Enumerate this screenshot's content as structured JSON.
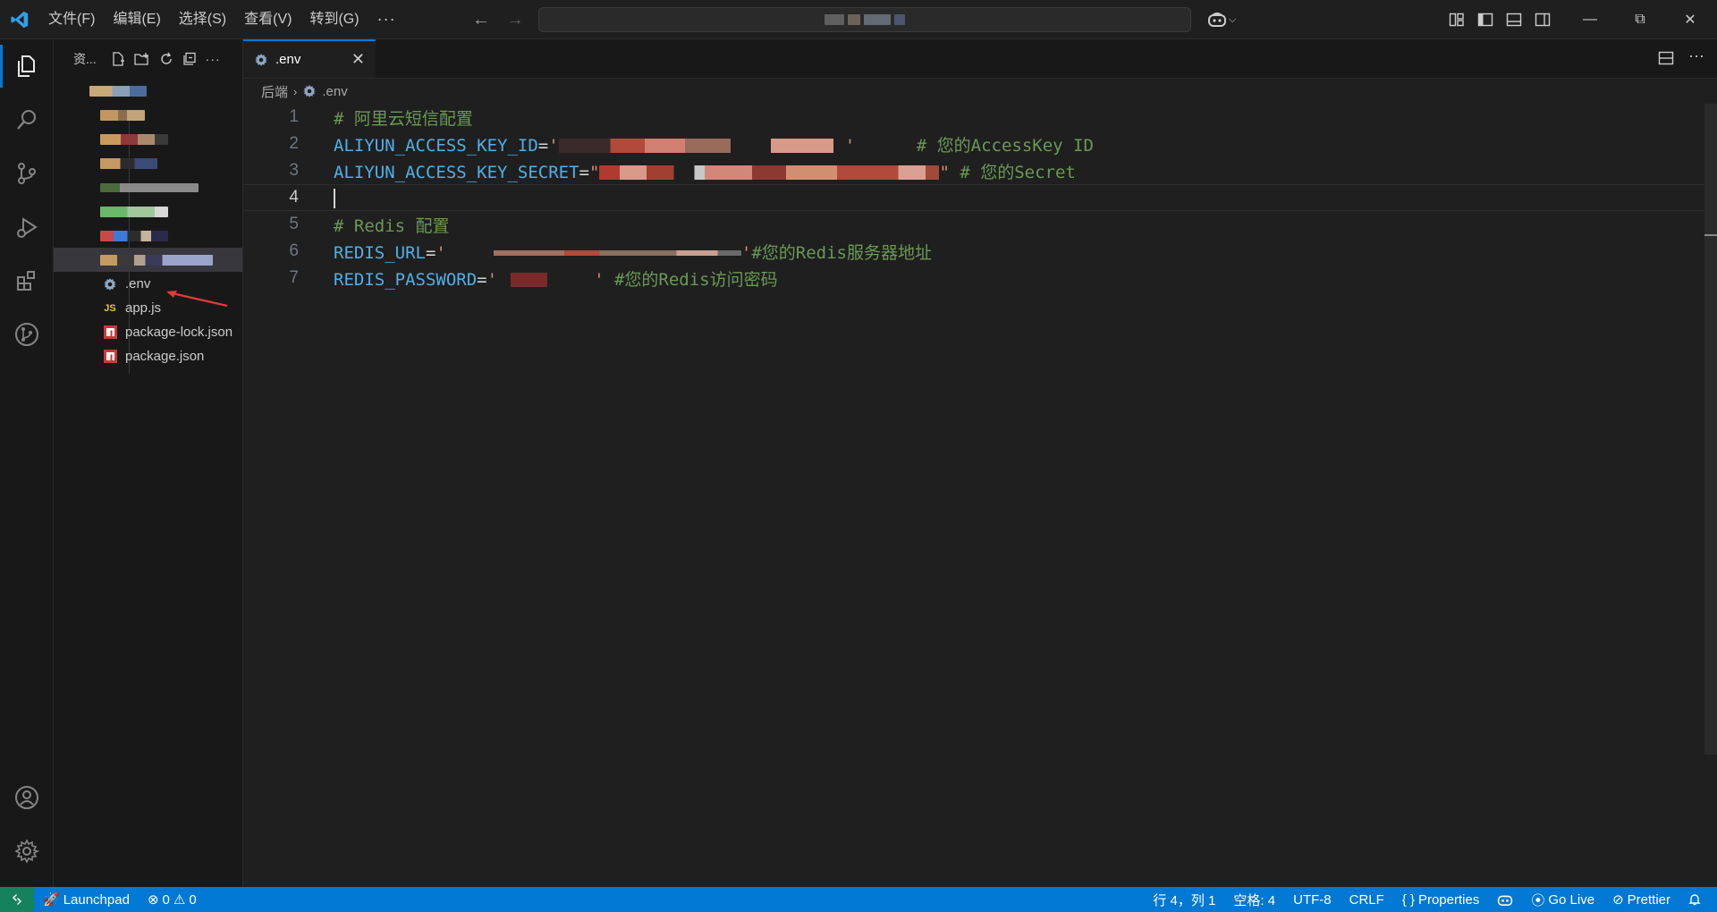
{
  "window": {
    "menu": [
      "文件(F)",
      "编辑(E)",
      "选择(S)",
      "查看(V)",
      "转到(G)"
    ],
    "more_menu": "···",
    "controls": [
      "minimize",
      "restore",
      "close"
    ]
  },
  "icons": {
    "app_logo": "vscode-logo",
    "activity": [
      "files-icon",
      "search-icon",
      "source-control-icon",
      "run-debug-icon",
      "extensions-icon",
      "git-graph-icon"
    ],
    "activity_bottom": [
      "account-icon",
      "settings-gear-icon"
    ]
  },
  "sidebar": {
    "title": "资...",
    "files": [
      {
        "label": ".env",
        "icon": "gear-icon"
      },
      {
        "label": "app.js",
        "icon": "js-icon"
      },
      {
        "label": "package-lock.json",
        "icon": "npm-icon"
      },
      {
        "label": "package.json",
        "icon": "npm-icon"
      }
    ]
  },
  "editor": {
    "tab": {
      "label": ".env"
    },
    "breadcrumb": {
      "folder": "后端",
      "file": ".env"
    },
    "lines": [
      {
        "num": "1",
        "comment": "# 阿里云短信配置"
      },
      {
        "num": "2",
        "key": "ALIYUN_ACCESS_KEY_ID",
        "op": "=",
        "q1": "'",
        "q2": "'",
        "comment": "# 您的AccessKey ID"
      },
      {
        "num": "3",
        "key": "ALIYUN_ACCESS_KEY_SECRET",
        "op": "=",
        "q1": "\"",
        "q2": "\"",
        "comment": "# 您的Secret"
      },
      {
        "num": "4"
      },
      {
        "num": "5",
        "comment": "# Redis 配置"
      },
      {
        "num": "6",
        "key": "REDIS_URL",
        "op": "=",
        "q1": "'",
        "q2": "'",
        "comment": "#您的Redis服务器地址"
      },
      {
        "num": "7",
        "key": "REDIS_PASSWORD",
        "op": "=",
        "q1": "'",
        "q2": "'",
        "comment": "#您的Redis访问密码"
      }
    ]
  },
  "statusbar": {
    "launchpad": "Launchpad",
    "errors": "0",
    "warnings": "0",
    "position": "行 4，列 1",
    "spaces": "空格: 4",
    "encoding": "UTF-8",
    "eol": "CRLF",
    "language": "Properties",
    "golive": "Go Live",
    "prettier": "Prettier"
  },
  "colors": {
    "accent": "#0078d4",
    "remote": "#16825d",
    "comment": "#6a9955",
    "key": "#4fb0e8",
    "string": "#ce9178",
    "annotation_arrow": "#e03a3a"
  }
}
